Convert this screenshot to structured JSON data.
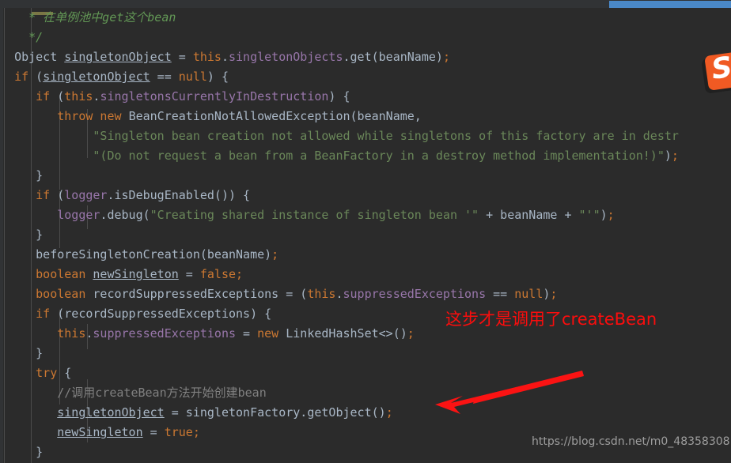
{
  "window": {
    "background_color": "#2b2b2b",
    "gutter_color": "#313335",
    "scrollbar_color": "#4a88c7"
  },
  "code": {
    "language": "java",
    "lines": [
      [
        {
          "t": "    ",
          "c": "c-default"
        },
        {
          "t": "* 在单例池中get这个bean",
          "c": "c-doccom"
        }
      ],
      [
        {
          "t": "    ",
          "c": "c-default"
        },
        {
          "t": "*/",
          "c": "c-doccom"
        }
      ],
      [
        {
          "t": "  ",
          "c": "c-default"
        },
        {
          "t": "Object ",
          "c": "c-class"
        },
        {
          "t": "singletonObject",
          "c": "c-local"
        },
        {
          "t": " = ",
          "c": "c-default"
        },
        {
          "t": "this",
          "c": "c-keyword"
        },
        {
          "t": ".",
          "c": "c-default"
        },
        {
          "t": "singletonObjects",
          "c": "c-field"
        },
        {
          "t": ".get(beanName)",
          "c": "c-default"
        },
        {
          "t": ";",
          "c": "c-semi"
        }
      ],
      [
        {
          "t": "  ",
          "c": "c-default"
        },
        {
          "t": "if",
          "c": "c-keyword"
        },
        {
          "t": " (",
          "c": "c-default"
        },
        {
          "t": "singletonObject",
          "c": "c-local"
        },
        {
          "t": " == ",
          "c": "c-default"
        },
        {
          "t": "null",
          "c": "c-keyword"
        },
        {
          "t": ") {",
          "c": "c-default"
        }
      ],
      [
        {
          "t": "     ",
          "c": "c-default"
        },
        {
          "t": "if",
          "c": "c-keyword"
        },
        {
          "t": " (",
          "c": "c-default"
        },
        {
          "t": "this",
          "c": "c-keyword"
        },
        {
          "t": ".",
          "c": "c-default"
        },
        {
          "t": "singletonsCurrentlyInDestruction",
          "c": "c-field"
        },
        {
          "t": ") {",
          "c": "c-default"
        }
      ],
      [
        {
          "t": "        ",
          "c": "c-default"
        },
        {
          "t": "throw new ",
          "c": "c-keyword"
        },
        {
          "t": "BeanCreationNotAllowedException(beanName,",
          "c": "c-default"
        }
      ],
      [
        {
          "t": "             ",
          "c": "c-default"
        },
        {
          "t": "\"Singleton bean creation not allowed while singletons of this factory are in destr",
          "c": "c-string"
        }
      ],
      [
        {
          "t": "             ",
          "c": "c-default"
        },
        {
          "t": "\"(Do not request a bean from a BeanFactory in a destroy method implementation!)\"",
          "c": "c-string"
        },
        {
          "t": ")",
          "c": "c-default"
        },
        {
          "t": ";",
          "c": "c-semi"
        }
      ],
      [
        {
          "t": "     ",
          "c": "c-default"
        },
        {
          "t": "}",
          "c": "c-default"
        }
      ],
      [
        {
          "t": "     ",
          "c": "c-default"
        },
        {
          "t": "if",
          "c": "c-keyword"
        },
        {
          "t": " (",
          "c": "c-default"
        },
        {
          "t": "logger",
          "c": "c-field"
        },
        {
          "t": ".isDebugEnabled()) {",
          "c": "c-default"
        }
      ],
      [
        {
          "t": "        ",
          "c": "c-default"
        },
        {
          "t": "logger",
          "c": "c-field"
        },
        {
          "t": ".debug(",
          "c": "c-default"
        },
        {
          "t": "\"Creating shared instance of singleton bean '\"",
          "c": "c-string"
        },
        {
          "t": " + ",
          "c": "c-default"
        },
        {
          "t": "beanName",
          "c": "c-default"
        },
        {
          "t": " + ",
          "c": "c-default"
        },
        {
          "t": "\"'\"",
          "c": "c-string"
        },
        {
          "t": ")",
          "c": "c-default"
        },
        {
          "t": ";",
          "c": "c-semi"
        }
      ],
      [
        {
          "t": "     ",
          "c": "c-default"
        },
        {
          "t": "}",
          "c": "c-default"
        }
      ],
      [
        {
          "t": "     ",
          "c": "c-default"
        },
        {
          "t": "beforeSingletonCreation(beanName)",
          "c": "c-default"
        },
        {
          "t": ";",
          "c": "c-semi"
        }
      ],
      [
        {
          "t": "     ",
          "c": "c-default"
        },
        {
          "t": "boolean ",
          "c": "c-keyword"
        },
        {
          "t": "newSingleton",
          "c": "c-local"
        },
        {
          "t": " = ",
          "c": "c-default"
        },
        {
          "t": "false",
          "c": "c-keyword"
        },
        {
          "t": ";",
          "c": "c-semi"
        }
      ],
      [
        {
          "t": "     ",
          "c": "c-default"
        },
        {
          "t": "boolean ",
          "c": "c-keyword"
        },
        {
          "t": "recordSuppressedExceptions = (",
          "c": "c-default"
        },
        {
          "t": "this",
          "c": "c-keyword"
        },
        {
          "t": ".",
          "c": "c-default"
        },
        {
          "t": "suppressedExceptions",
          "c": "c-field"
        },
        {
          "t": " == ",
          "c": "c-default"
        },
        {
          "t": "null",
          "c": "c-keyword"
        },
        {
          "t": ")",
          "c": "c-default"
        },
        {
          "t": ";",
          "c": "c-semi"
        }
      ],
      [
        {
          "t": "     ",
          "c": "c-default"
        },
        {
          "t": "if",
          "c": "c-keyword"
        },
        {
          "t": " (recordSuppressedExceptions) {",
          "c": "c-default"
        }
      ],
      [
        {
          "t": "        ",
          "c": "c-default"
        },
        {
          "t": "this",
          "c": "c-keyword"
        },
        {
          "t": ".",
          "c": "c-default"
        },
        {
          "t": "suppressedExceptions",
          "c": "c-field"
        },
        {
          "t": " = ",
          "c": "c-default"
        },
        {
          "t": "new ",
          "c": "c-keyword"
        },
        {
          "t": "LinkedHashSet<>()",
          "c": "c-default"
        },
        {
          "t": ";",
          "c": "c-semi"
        }
      ],
      [
        {
          "t": "     ",
          "c": "c-default"
        },
        {
          "t": "}",
          "c": "c-default"
        }
      ],
      [
        {
          "t": "     ",
          "c": "c-default"
        },
        {
          "t": "try",
          "c": "c-keyword"
        },
        {
          "t": " {",
          "c": "c-default"
        }
      ],
      [
        {
          "t": "        ",
          "c": "c-default"
        },
        {
          "t": "//调用createBean方法开始创建bean",
          "c": "c-comment"
        }
      ],
      [
        {
          "t": "        ",
          "c": "c-default"
        },
        {
          "t": "singletonObject",
          "c": "c-local"
        },
        {
          "t": " = singletonFactory.getObject()",
          "c": "c-default"
        },
        {
          "t": ";",
          "c": "c-semi"
        }
      ],
      [
        {
          "t": "        ",
          "c": "c-default"
        },
        {
          "t": "newSingleton",
          "c": "c-local"
        },
        {
          "t": " = ",
          "c": "c-default"
        },
        {
          "t": "true",
          "c": "c-keyword"
        },
        {
          "t": ";",
          "c": "c-semi"
        }
      ],
      [
        {
          "t": "     ",
          "c": "c-default"
        },
        {
          "t": "}",
          "c": "c-default"
        }
      ]
    ]
  },
  "annotations": {
    "red_note": "这步才是调用了createBean",
    "red_color": "#fb0d0d",
    "arrow": {
      "color": "#fb1313",
      "from": "upper-right",
      "to": "lower-left"
    }
  },
  "watermark": {
    "text": "https://blog.csdn.net/m0_48358308"
  },
  "ime_badge": {
    "glyph": "S",
    "color": "#f05a23"
  }
}
